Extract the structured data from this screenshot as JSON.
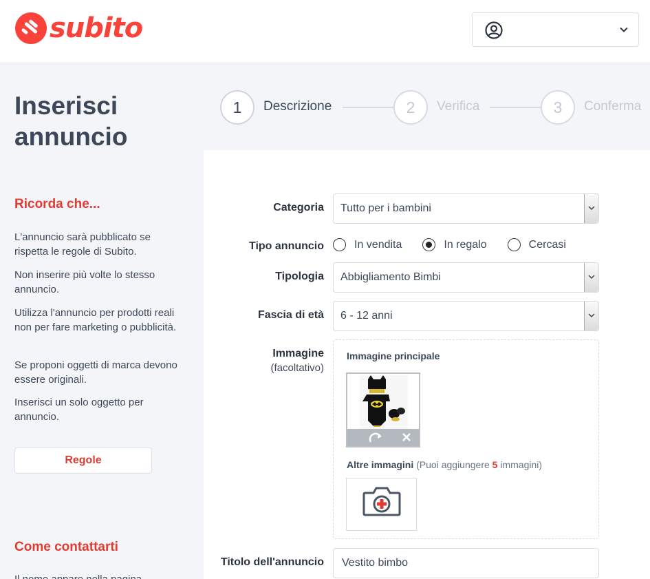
{
  "header": {
    "logo_text": "subito",
    "brand_color": "#f9423a",
    "user_icon": "user-circle-icon",
    "dropdown_icon": "chevron-down-icon"
  },
  "sidebar": {
    "title": "Inserisci annuncio",
    "remember_heading": "Ricorda che...",
    "tips": [
      "L'annuncio sarà pubblicato se rispetta le regole di Subito.",
      "Non inserire più volte lo stesso annuncio.",
      "Utilizza l'annuncio per prodotti reali non per fare marketing o pubblicità.",
      "Se proponi oggetti di marca devono essere originali.",
      "Inserisci un solo oggetto per annuncio."
    ],
    "rules_button": "Regole",
    "contact_heading": "Come contattarti",
    "contact_text": "Il nome appare nella pagina"
  },
  "stepper": {
    "steps": [
      {
        "number": "1",
        "label": "Descrizione",
        "active": true
      },
      {
        "number": "2",
        "label": "Verifica",
        "active": false
      },
      {
        "number": "3",
        "label": "Conferma",
        "active": false
      }
    ]
  },
  "form": {
    "category_label": "Categoria",
    "category_value": "Tutto per i bambini",
    "ad_type_label": "Tipo annuncio",
    "ad_type_options": [
      {
        "label": "In vendita",
        "checked": false
      },
      {
        "label": "In regalo",
        "checked": true
      },
      {
        "label": "Cercasi",
        "checked": false
      }
    ],
    "typology_label": "Tipologia",
    "typology_value": "Abbigliamento Bimbi",
    "age_label": "Fascia di età",
    "age_value": "6 - 12 anni",
    "image_label": "Immagine",
    "image_optional": "(facoltativo)",
    "main_image_title": "Immagine principale",
    "main_image_icons": [
      "rotate-icon",
      "close-icon"
    ],
    "other_images_title": "Altre immagini",
    "other_images_prefix": "(Puoi aggiungere ",
    "other_images_count": "5",
    "other_images_suffix": " immagini)",
    "add_photo_icon": "camera-add-icon",
    "title_label": "Titolo dell'annuncio",
    "title_value": "Vestito bimbo"
  },
  "colors": {
    "accent": "#e03c31",
    "text": "#3c4858",
    "background": "#f4f5f9"
  }
}
